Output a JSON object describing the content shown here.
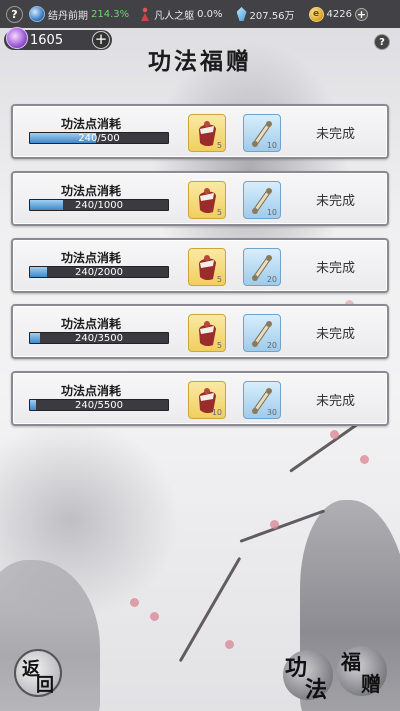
{
  "topbar": {
    "help_label": "?",
    "realm_label": "结丹前期",
    "realm_pct": "214.3%",
    "body_label": "凡人之躯",
    "body_pct": "0.0%",
    "spirit_stones": "207.56万",
    "gold": "4226",
    "gold_plus": "+"
  },
  "points": {
    "value": "1605",
    "add_label": "+"
  },
  "help_right": "?",
  "title": "功法福赠",
  "tasks": [
    {
      "label": "功法点消耗",
      "progress_text": "240/500",
      "progress": 0.48,
      "reward_gold_qty": "5",
      "reward_blue_qty": "10",
      "status": "未完成"
    },
    {
      "label": "功法点消耗",
      "progress_text": "240/1000",
      "progress": 0.24,
      "reward_gold_qty": "5",
      "reward_blue_qty": "10",
      "status": "未完成"
    },
    {
      "label": "功法点消耗",
      "progress_text": "240/2000",
      "progress": 0.12,
      "reward_gold_qty": "5",
      "reward_blue_qty": "20",
      "status": "未完成"
    },
    {
      "label": "功法点消耗",
      "progress_text": "240/3500",
      "progress": 0.069,
      "reward_gold_qty": "5",
      "reward_blue_qty": "20",
      "status": "未完成"
    },
    {
      "label": "功法点消耗",
      "progress_text": "240/5500",
      "progress": 0.044,
      "reward_gold_qty": "10",
      "reward_blue_qty": "30",
      "status": "未完成"
    }
  ],
  "back_button": {
    "char1": "返",
    "char2": "回"
  },
  "gift_button": {
    "char1": "功",
    "char2": "法",
    "char3": "福",
    "char4": "赠"
  }
}
